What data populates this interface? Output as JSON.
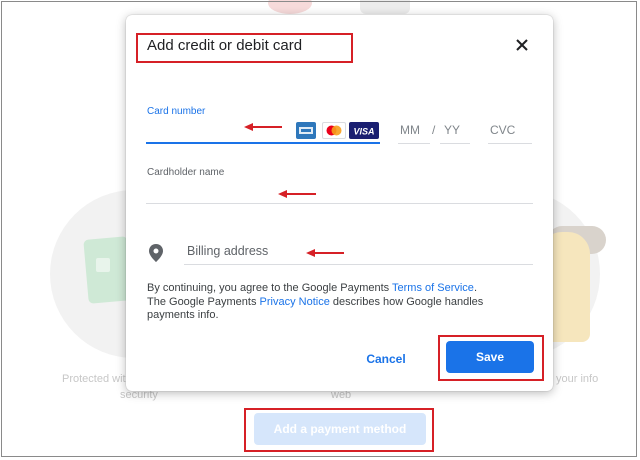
{
  "background": {
    "caption_left": "Protected wit",
    "caption_left_2": "security",
    "caption_mid": "web",
    "caption_right": "your info",
    "add_payment_label": "Add a payment method"
  },
  "dialog": {
    "title": "Add credit or debit card",
    "card_number_label": "Card number",
    "card_logos": [
      "amex",
      "mastercard",
      "VISA"
    ],
    "expiry_month_placeholder": "MM",
    "expiry_separator": "/",
    "expiry_year_placeholder": "YY",
    "cvc_placeholder": "CVC",
    "cardholder_label": "Cardholder name",
    "billing_address_placeholder": "Billing address",
    "terms": {
      "part1": "By continuing, you agree to the Google Payments ",
      "link1": "Terms of Service",
      "part2": ".",
      "part3": "The Google Payments ",
      "link2": "Privacy Notice",
      "part4": " describes how Google handles payments info."
    },
    "cancel_label": "Cancel",
    "save_label": "Save"
  },
  "colors": {
    "accent": "#1a73e8",
    "highlight": "#d62026"
  }
}
